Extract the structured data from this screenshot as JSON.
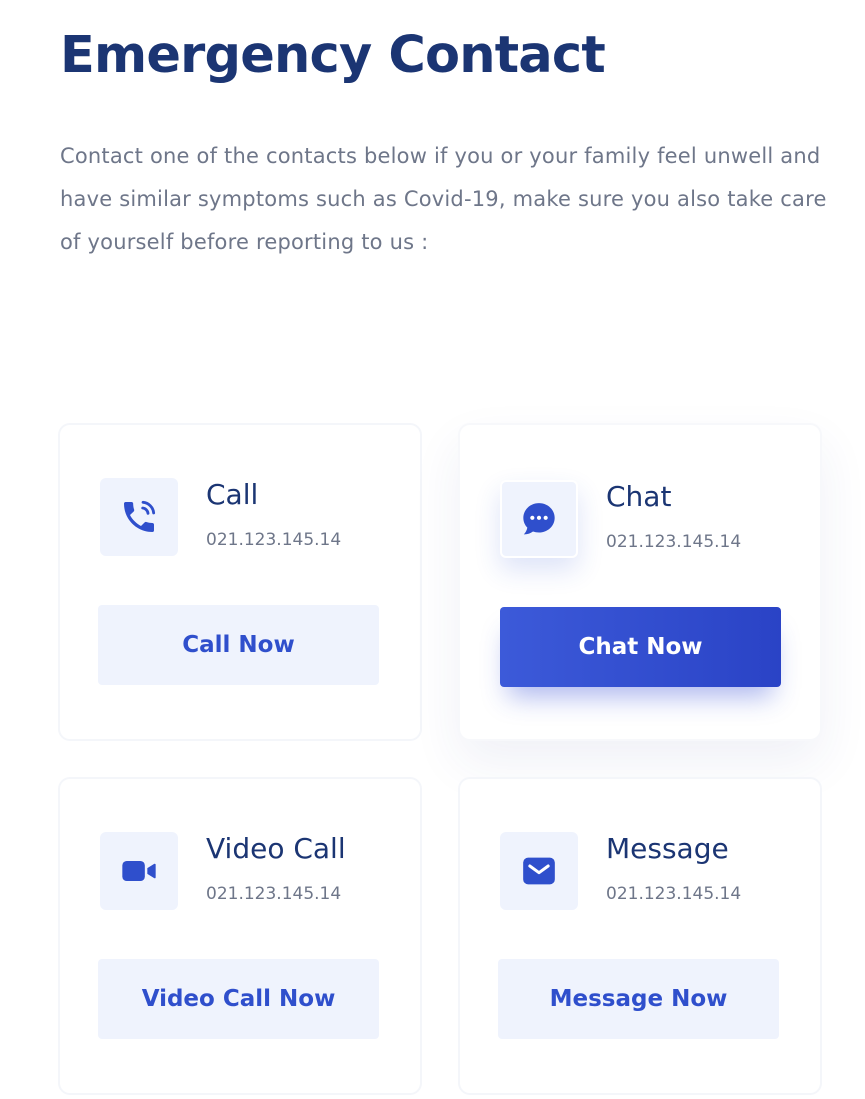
{
  "header": {
    "title": "Emergency Contact",
    "description": "Contact one of the contacts below if you or your family feel unwell and have similar symptoms such as Covid-19, make sure you also take care of yourself before reporting to us :"
  },
  "theme": {
    "primary": "#2f4fcc",
    "primary_gradient_end": "#2a43c6",
    "title_color": "#1b3573",
    "text_muted": "#6e7689",
    "light_fill": "#eff3fd"
  },
  "cards": [
    {
      "icon": "phone-call-icon",
      "title": "Call",
      "number": "021.123.145.14",
      "button_label": "Call Now"
    },
    {
      "icon": "chat-bubble-icon",
      "title": "Chat",
      "number": "021.123.145.14",
      "button_label": "Chat Now",
      "active": true
    },
    {
      "icon": "video-camera-icon",
      "title": "Video Call",
      "number": "021.123.145.14",
      "button_label": "Video Call Now"
    },
    {
      "icon": "envelope-icon",
      "title": "Message",
      "number": "021.123.145.14",
      "button_label": "Message Now"
    }
  ]
}
